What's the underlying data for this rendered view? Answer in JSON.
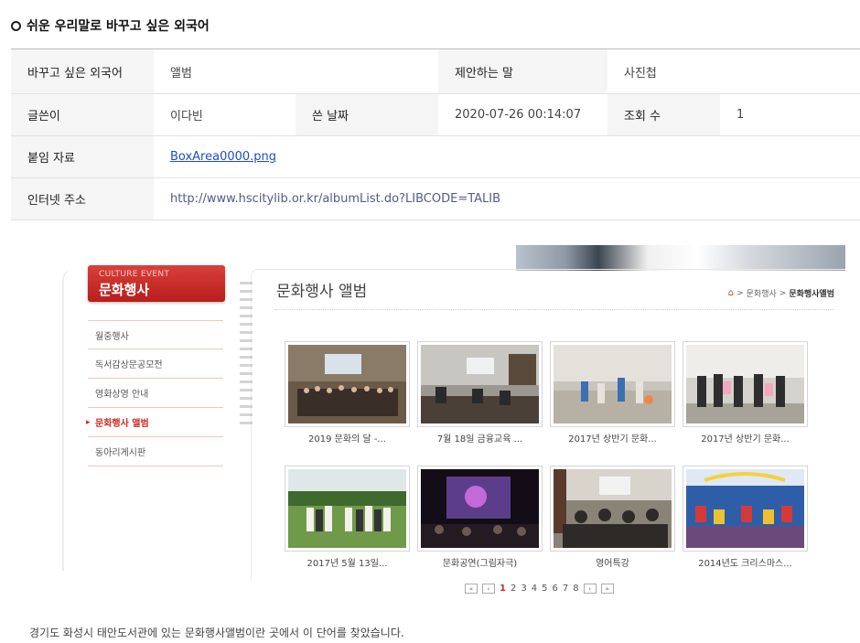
{
  "section": {
    "title": "쉬운 우리말로 바꾸고 싶은 외국어"
  },
  "info": {
    "row1": {
      "label1": "바꾸고 싶은 외국어",
      "value1": "앨범",
      "label2": "제안하는 말",
      "value2": "사진첩"
    },
    "row2": {
      "label1": "글쓴이",
      "value1": "이다빈",
      "label2": "쓴 날짜",
      "value2": "2020-07-26 00:14:07",
      "label3": "조회 수",
      "value3": "1"
    },
    "row3": {
      "label": "붙임 자료",
      "value": "BoxArea0000.png"
    },
    "row4": {
      "label": "인터넷 주소",
      "value": "http://www.hscitylib.or.kr/albumList.do?LIBCODE=TALIB"
    }
  },
  "embed": {
    "sidebar": {
      "title_en": "CULTURE EVENT",
      "title_ko": "문화행사",
      "items": [
        {
          "label": "월중행사"
        },
        {
          "label": "독서감상문공모전"
        },
        {
          "label": "영화상영 안내"
        },
        {
          "label": "문화행사 앨범"
        },
        {
          "label": "동아리게시판"
        }
      ]
    },
    "content_title": "문화행사 앨범",
    "breadcrumb": {
      "home_icon": "home-icon",
      "item1": "문화행사",
      "item2": "문화행사앨범"
    },
    "albums": [
      {
        "caption": "2019 문화의 달 -..."
      },
      {
        "caption": "7월 18일 금융교육 ..."
      },
      {
        "caption": "2017년 상반기 문화..."
      },
      {
        "caption": "2017년 상반기 문화..."
      },
      {
        "caption": "2017년 5월 13일..."
      },
      {
        "caption": "문화공연(그림자극)"
      },
      {
        "caption": "영어특강"
      },
      {
        "caption": "2014년도 크리스마스..."
      }
    ],
    "pager": {
      "first": "«",
      "prev": "‹",
      "pages": [
        "1",
        "2",
        "3",
        "4",
        "5",
        "6",
        "7",
        "8"
      ],
      "current": "1",
      "next": "›",
      "last": "»"
    }
  },
  "footer": {
    "text": "경기도 화성시 태안도서관에 있는 문화행사앨범이란 곳에서 이 단어를 찾았습니다."
  }
}
